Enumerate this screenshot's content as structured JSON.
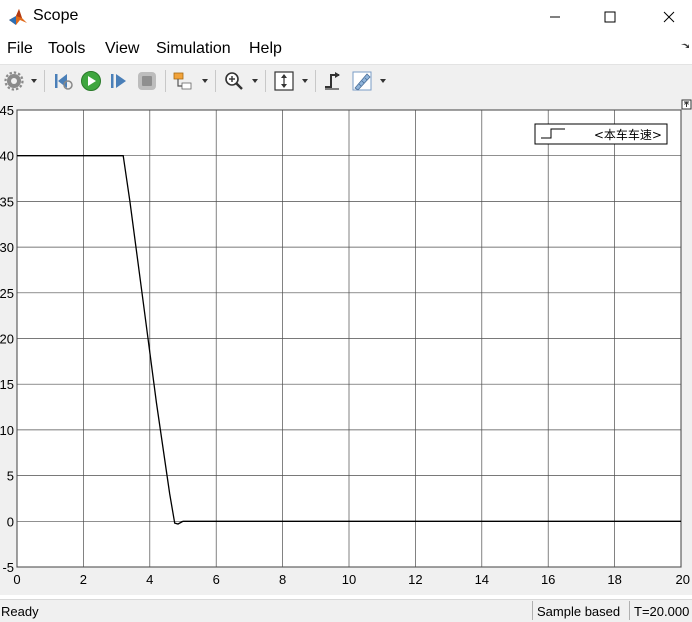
{
  "window": {
    "title": "Scope"
  },
  "menu": {
    "items": [
      "File",
      "Tools",
      "View",
      "Simulation",
      "Help"
    ]
  },
  "toolbar": {
    "buttons": [
      {
        "name": "settings",
        "icon": "gear-icon"
      },
      {
        "name": "step-back",
        "icon": "step-back-icon"
      },
      {
        "name": "run",
        "icon": "play-icon"
      },
      {
        "name": "step-forward",
        "icon": "step-forward-icon"
      },
      {
        "name": "stop",
        "icon": "stop-icon"
      },
      {
        "name": "highlight-block",
        "icon": "highlight-block-icon"
      },
      {
        "name": "zoom",
        "icon": "zoom-in-icon"
      },
      {
        "name": "scale-axes",
        "icon": "scale-axes-icon"
      },
      {
        "name": "triggers",
        "icon": "trigger-icon"
      },
      {
        "name": "measurements",
        "icon": "ruler-icon"
      }
    ]
  },
  "colors": {
    "plot_bg": "#ffffff",
    "grid": "#4d4d4d",
    "line": "#000000",
    "chrome": "#f0f0f0"
  },
  "chart_data": {
    "type": "line",
    "xlim": [
      0,
      20
    ],
    "ylim": [
      -5,
      45
    ],
    "xticks": [
      0,
      2,
      4,
      6,
      8,
      10,
      12,
      14,
      16,
      18,
      20
    ],
    "yticks": [
      -5,
      0,
      5,
      10,
      15,
      20,
      25,
      30,
      35,
      40,
      45
    ],
    "grid": true,
    "legend_position": "top-right",
    "series": [
      {
        "name": "<本车车速>",
        "x": [
          0,
          3.2,
          3.4,
          3.8,
          4.2,
          4.6,
          4.75,
          4.85,
          5.0,
          20
        ],
        "y": [
          40,
          40,
          35,
          24,
          13,
          3,
          -0.2,
          -0.3,
          0,
          0
        ]
      }
    ]
  },
  "status": {
    "left": "Ready",
    "mode": "Sample based",
    "time": "T=20.000"
  }
}
